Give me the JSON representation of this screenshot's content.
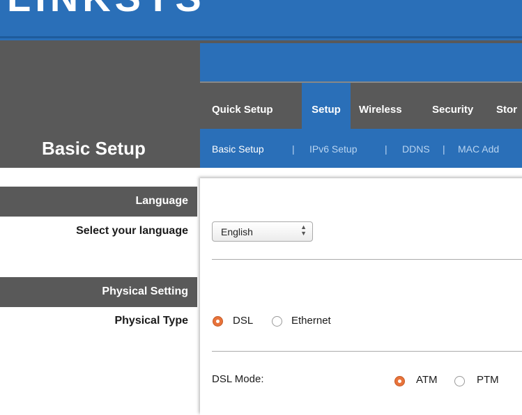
{
  "brand": {
    "logo_text": "LINKSYS"
  },
  "header": {
    "page_title": "Basic Setup"
  },
  "nav": {
    "tabs": [
      {
        "label": "Quick Setup",
        "active": false
      },
      {
        "label": "Setup",
        "active": true
      },
      {
        "label": "Wireless",
        "active": false
      },
      {
        "label": "Security",
        "active": false
      },
      {
        "label": "Stor",
        "active": false
      }
    ],
    "subtabs": [
      {
        "label": "Basic Setup",
        "active": true
      },
      {
        "label": "IPv6 Setup",
        "active": false
      },
      {
        "label": "DDNS",
        "active": false
      },
      {
        "label": "MAC Add",
        "active": false
      }
    ],
    "separator": "|"
  },
  "sections": {
    "language": {
      "title": "Language",
      "label": "Select your language",
      "value": "English"
    },
    "physical": {
      "title": "Physical Setting",
      "type_label": "Physical Type",
      "type_options": [
        {
          "label": "DSL",
          "checked": true
        },
        {
          "label": "Ethernet",
          "checked": false
        }
      ],
      "dsl_mode_label": "DSL Mode:",
      "dsl_mode_options": [
        {
          "label": "ATM",
          "checked": true
        },
        {
          "label": "PTM",
          "checked": false
        }
      ]
    }
  },
  "colors": {
    "brand_blue": "#2a6fb8",
    "header_gray": "#595959",
    "radio_accent": "#e8733b"
  }
}
